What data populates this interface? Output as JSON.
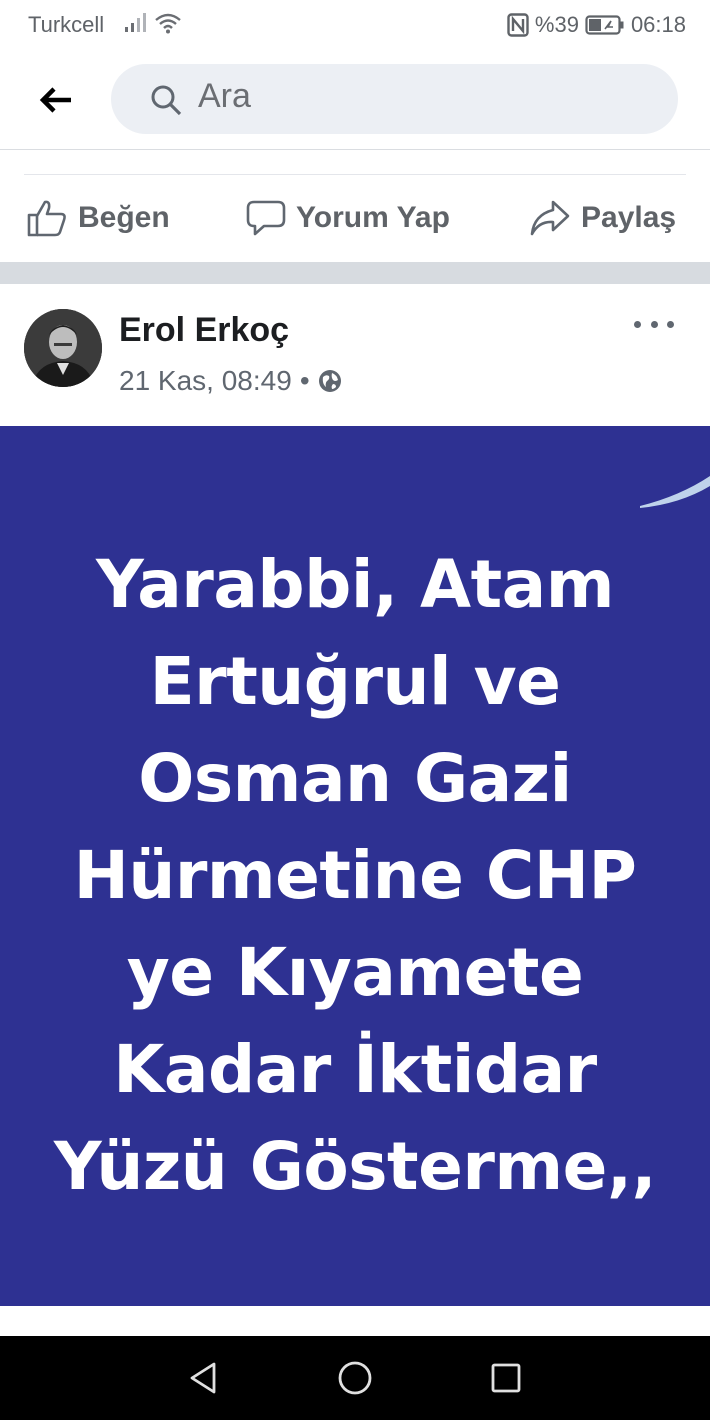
{
  "status_bar": {
    "carrier": "Turkcell",
    "battery": "%39",
    "time": "06:18",
    "icons": [
      "signal-icon",
      "wifi-icon",
      "nfc-icon",
      "battery-icon"
    ]
  },
  "topbar": {
    "back_icon": "arrow-left-icon",
    "search_placeholder": "Ara"
  },
  "actions": {
    "like": "Beğen",
    "comment": "Yorum Yap",
    "share": "Paylaş"
  },
  "post": {
    "author": "Erol Erkoç",
    "timestamp": "21 Kas, 08:49",
    "separator": "•",
    "privacy_icon": "globe-icon",
    "more_icon": "more-dots-icon",
    "image_lines": [
      "Yarabbi, Atam",
      "Ertuğrul ve",
      "Osman Gazi",
      "Hürmetine CHP",
      "ye Kıyamete",
      "Kadar İktidar",
      "Yüzü Gösterme,,"
    ],
    "image_background": "#2e3192"
  },
  "nav": {
    "icons": [
      "back-triangle-icon",
      "home-circle-icon",
      "recents-square-icon"
    ]
  }
}
